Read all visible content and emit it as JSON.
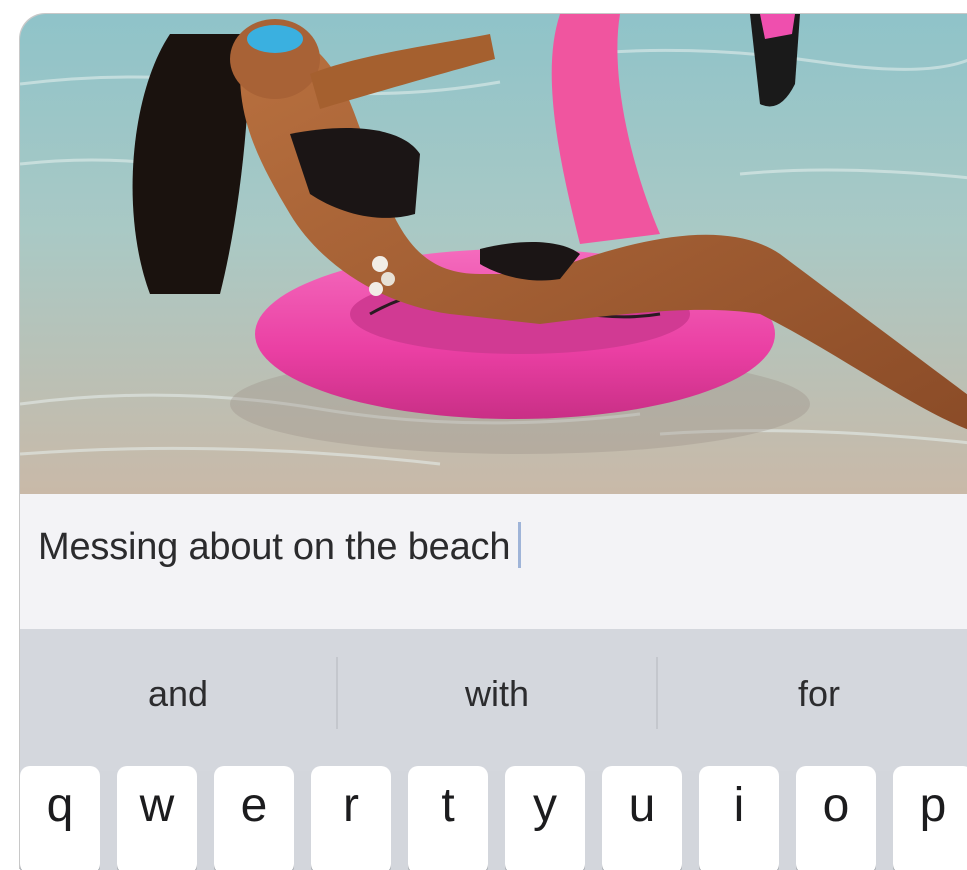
{
  "caption": {
    "text": "Messing about on the beach"
  },
  "predictions": [
    "and",
    "with",
    "for"
  ],
  "keyboard": {
    "top_row": [
      "q",
      "w",
      "e",
      "r",
      "t",
      "y",
      "u",
      "i",
      "o",
      "p"
    ]
  },
  "colors": {
    "caption_background": "#f3f3f6",
    "keyboard_background": "#d4d7dd",
    "key_background": "#ffffff",
    "caret": "#9fb4d8",
    "float_pink": "#ef4fae"
  }
}
